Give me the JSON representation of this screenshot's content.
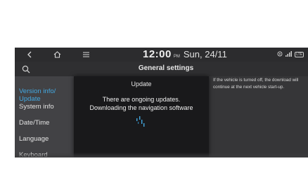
{
  "status_bar": {
    "back_icon": "back-chevron-icon",
    "home_icon": "home-icon",
    "menu_icon": "menu-icon",
    "time": "12:00",
    "ampm": "PM",
    "date": "Sun, 24/11",
    "gps_icon": "gps-icon",
    "signal_icon": "signal-icon",
    "lte_badge": "LTE"
  },
  "header": {
    "search_icon": "search-icon",
    "title": "General settings"
  },
  "sidebar": {
    "items": [
      {
        "label": "Version info/\nUpdate",
        "active": true
      },
      {
        "label": "System info",
        "active": false
      },
      {
        "label": "Date/Time",
        "active": false
      },
      {
        "label": "Language",
        "active": false
      },
      {
        "label": "Keyboard",
        "active": false
      }
    ]
  },
  "main": {
    "info_text": "If the vehicle is turned off, the download will continue at the next vehicle start-up."
  },
  "popup": {
    "title": "Update",
    "message_line1": "There are ongoing updates.",
    "message_line2": "Downloading the navigation software",
    "spinner_icon": "loading-spinner-icon"
  },
  "colors": {
    "accent": "#43a8e0",
    "screen_bg": "#3b3b3d",
    "popup_bg": "#19191b"
  }
}
